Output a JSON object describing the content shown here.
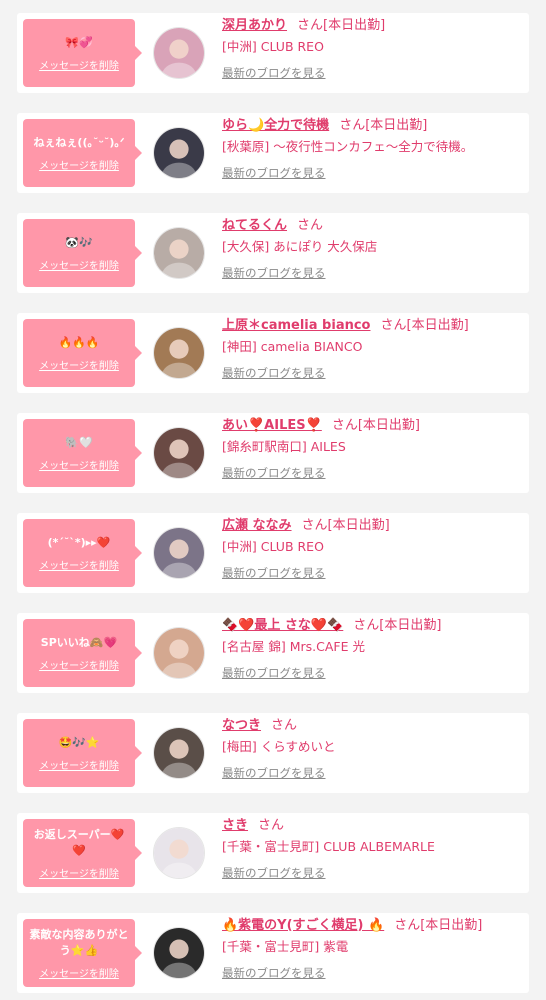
{
  "items": [
    {
      "message": "🎀💞",
      "delete_label": "メッセージを削除",
      "name": "深月あかり",
      "honorific": "さん",
      "status": "[本日出勤]",
      "shop": "[中洲] CLUB REO",
      "blog_link": "最新のブログを見る",
      "avatar_color": "#d9a3b8"
    },
    {
      "message": "ねぇねぇ((｡˘ᵕ˘)｡ᐟ",
      "delete_label": "メッセージを削除",
      "name": "ゆら🌙全力で待機",
      "honorific": "さん",
      "status": "[本日出勤]",
      "shop": "[秋葉原] 〜夜行性コンカフェ〜全力で待機。",
      "blog_link": "最新のブログを見る",
      "avatar_color": "#3a3a48"
    },
    {
      "message": "🐼🎶",
      "delete_label": "メッセージを削除",
      "name": "ねてるくん",
      "honorific": "さん",
      "status": "",
      "shop": "[大久保] あにぽり 大久保店",
      "blog_link": "最新のブログを見る",
      "avatar_color": "#b8aca6"
    },
    {
      "message": "🔥🔥🔥",
      "delete_label": "メッセージを削除",
      "name": "上原＊camelia bianco",
      "honorific": "さん",
      "status": "[本日出勤]",
      "shop": "[神田] camelia BIANCO",
      "blog_link": "最新のブログを見る",
      "avatar_color": "#a27a55"
    },
    {
      "message": "🐘🤍",
      "delete_label": "メッセージを削除",
      "name": "あい❣️AILES❣️",
      "honorific": "さん",
      "status": "[本日出勤]",
      "shop": "[錦糸町駅南口] AILES",
      "blog_link": "最新のブログを見る",
      "avatar_color": "#6a4a44"
    },
    {
      "message": "(*´˘`*)▸▸❤️",
      "delete_label": "メッセージを削除",
      "name": "広瀬 ななみ",
      "honorific": "さん",
      "status": "[本日出勤]",
      "shop": "[中洲] CLUB REO",
      "blog_link": "最新のブログを見る",
      "avatar_color": "#7c7488"
    },
    {
      "message": "SPいいね🙈💗",
      "delete_label": "メッセージを削除",
      "name": "🍫❤️最上 さな❤️🍫",
      "honorific": "さん",
      "status": "[本日出勤]",
      "shop": "[名古屋 錦] Mrs.CAFE 光",
      "blog_link": "最新のブログを見る",
      "avatar_color": "#d4a890"
    },
    {
      "message": "🤩🎶⭐️",
      "delete_label": "メッセージを削除",
      "name": "なつき",
      "honorific": "さん",
      "status": "",
      "shop": "[梅田] くらすめいと",
      "blog_link": "最新のブログを見る",
      "avatar_color": "#5a4e48"
    },
    {
      "message": "お返しスーパー❤️❤️",
      "delete_label": "メッセージを削除",
      "name": "さき",
      "honorific": "さん",
      "status": "",
      "shop": "[千葉・富士見町] CLUB ALBEMARLE",
      "blog_link": "最新のブログを見る",
      "avatar_color": "#e8e4ea"
    },
    {
      "message": "素敵な内容ありがとう⭐️👍",
      "delete_label": "メッセージを削除",
      "name": "🔥紫電のY(すごく横足) 🔥",
      "honorific": "さん",
      "status": "[本日出勤]",
      "shop": "[千葉・富士見町] 紫電",
      "blog_link": "最新のブログを見る",
      "avatar_color": "#2a2a2a"
    }
  ]
}
